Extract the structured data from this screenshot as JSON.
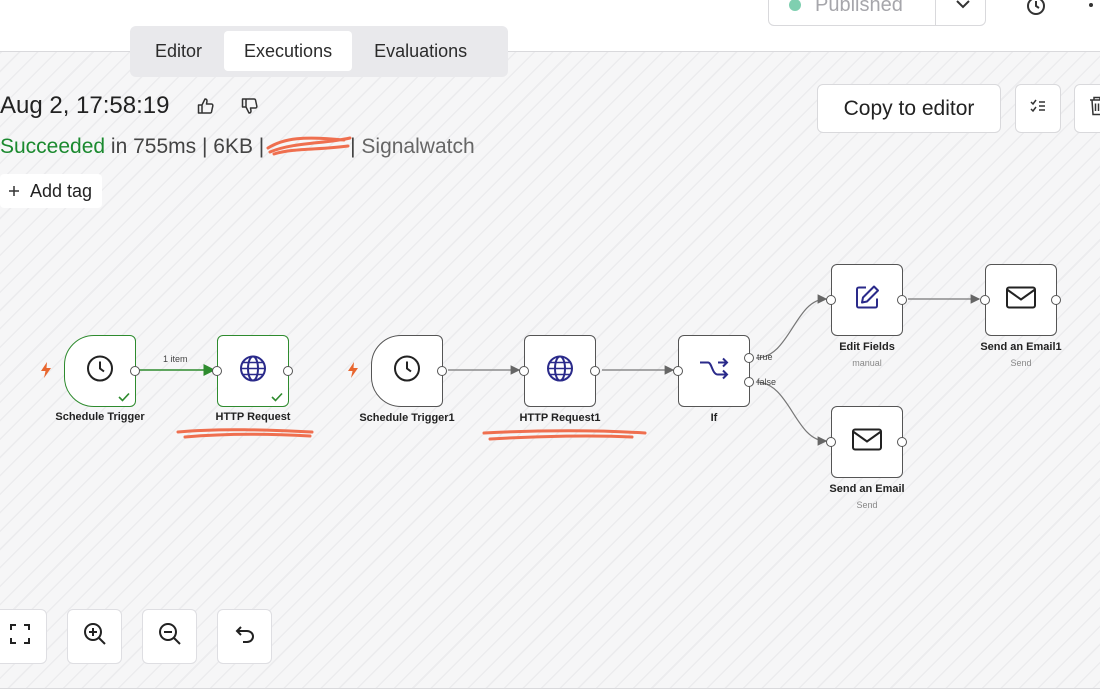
{
  "tabs": [
    {
      "label": "Editor",
      "active": false
    },
    {
      "label": "Executions",
      "active": true
    },
    {
      "label": "Evaluations",
      "active": false
    }
  ],
  "header": {
    "publish_status": "Published",
    "history_icon": "history-icon",
    "more_icon": "more-vertical-icon"
  },
  "execution": {
    "timestamp": "Aug 2, 17:58:19",
    "status": "Succeeded",
    "duration": " in 755ms | 6KB |",
    "separator": "|",
    "workflow_name": "Signalwatch",
    "add_tag": "Add tag"
  },
  "actions": {
    "copy_to_editor": "Copy to editor"
  },
  "nodes": {
    "schedule_trigger": {
      "label": "Schedule Trigger"
    },
    "http_request": {
      "label": "HTTP Request"
    },
    "schedule_trigger1": {
      "label": "Schedule Trigger1"
    },
    "http_request1": {
      "label": "HTTP Request1"
    },
    "if": {
      "label": "If"
    },
    "edit_fields": {
      "label": "Edit Fields",
      "sub": "manual"
    },
    "send_email1": {
      "label": "Send an Email1",
      "sub": "Send"
    },
    "send_email": {
      "label": "Send an Email",
      "sub": "Send"
    }
  },
  "edges": {
    "item_count": "1 item",
    "if_true": "true",
    "if_false": "false"
  },
  "colors": {
    "success": "#1b8a2f",
    "accent_node_icon": "#2a2a8a",
    "bolt": "#e8662f",
    "redaction": "#ef6f4f"
  }
}
